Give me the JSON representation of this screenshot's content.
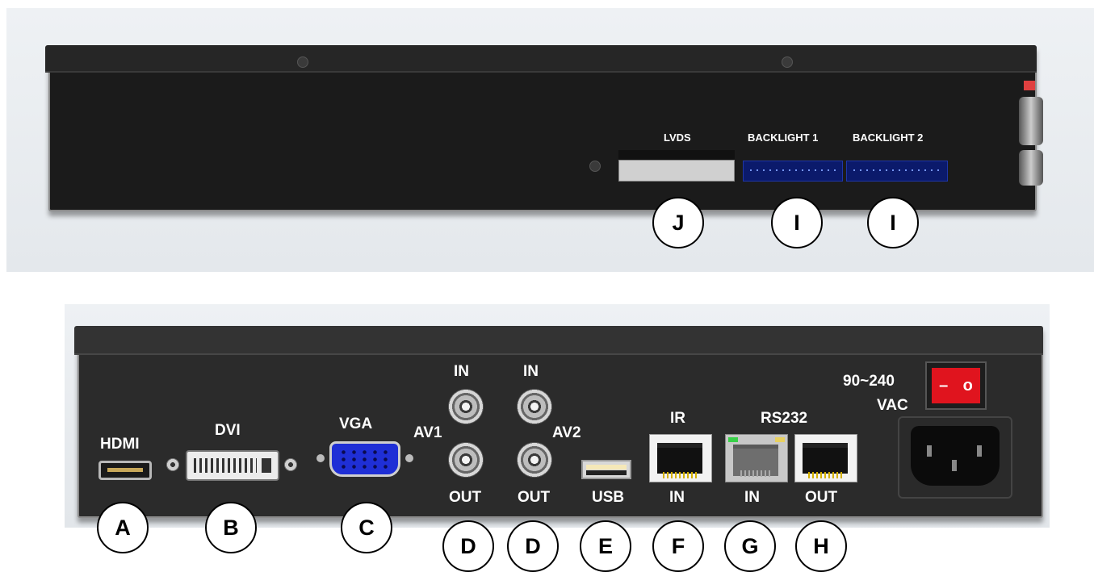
{
  "top_panel": {
    "labels": {
      "lvds": "LVDS",
      "backlight1": "BACKLIGHT 1",
      "backlight2": "BACKLIGHT 2"
    },
    "callouts": [
      "J",
      "I",
      "I"
    ]
  },
  "bottom_panel": {
    "labels": {
      "hdmi": "HDMI",
      "dvi": "DVI",
      "vga": "VGA",
      "av1": "AV1",
      "av2": "AV2",
      "av1_in": "IN",
      "av2_in": "IN",
      "av1_out": "OUT",
      "av2_out": "OUT",
      "usb": "USB",
      "ir": "IR",
      "ir_in": "IN",
      "rs232": "RS232",
      "rs232_in": "IN",
      "rs232_out": "OUT",
      "power_line1": "90~240",
      "power_line2": "VAC",
      "switch_off": "o",
      "switch_on": "–"
    },
    "callouts": [
      "A",
      "B",
      "C",
      "D",
      "D",
      "E",
      "F",
      "G",
      "H"
    ]
  },
  "colors": {
    "chassis": "#1b1b1b",
    "label": "#ffffff",
    "vga_blue": "#1f2fd6",
    "backlight_blue": "#0b1a6b",
    "power_switch_red": "#e0141e",
    "rj45_led_green": "#38d048",
    "rj45_led_yellow": "#e8d060"
  }
}
